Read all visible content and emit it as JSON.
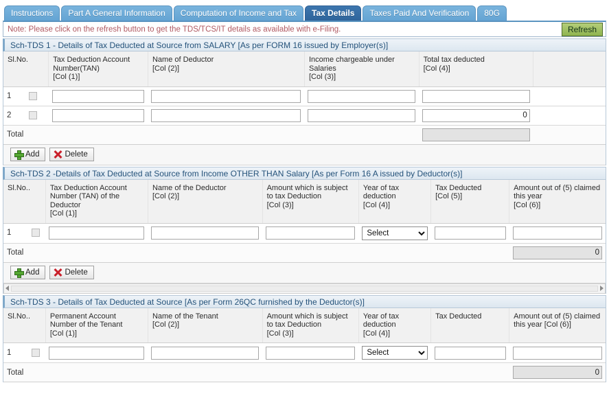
{
  "tabs": [
    {
      "label": "Instructions",
      "active": false
    },
    {
      "label": "Part A General Information",
      "active": false
    },
    {
      "label": "Computation of Income and Tax",
      "active": false
    },
    {
      "label": "Tax Details",
      "active": true
    },
    {
      "label": "Taxes Paid And Verification",
      "active": false
    },
    {
      "label": "80G",
      "active": false
    }
  ],
  "note": {
    "text": "Note: Please click on the refresh button to get the TDS/TCS/IT details as available with e-Filing.",
    "color": "#b05a63",
    "refresh_label": "Refresh"
  },
  "buttons": {
    "add_label": "Add",
    "delete_label": "Delete"
  },
  "common": {
    "total_label": "Total",
    "select_option": "Select"
  },
  "sections": [
    {
      "id": "sch-tds-1",
      "title": "Sch-TDS 1 - Details of Tax Deducted at Source from SALARY [As per FORM 16 issued by Employer(s)]",
      "headers": [
        "Sl.No.",
        "Tax Deduction Account Number(TAN)\n[Col (1)]",
        "Name of Deductor\n[Col (2)]",
        "Income chargeable under Salaries\n[Col (3)]",
        "Total tax deducted\n[Col (4)]"
      ],
      "rows": [
        {
          "slno": "1",
          "tan": "",
          "name": "",
          "income": "",
          "tax": ""
        },
        {
          "slno": "2",
          "tan": "",
          "name": "",
          "income": "",
          "tax": "0"
        }
      ],
      "total_value": "",
      "has_scrollbar": false
    },
    {
      "id": "sch-tds-2",
      "title": "Sch-TDS 2 -Details of Tax Deducted at Source from Income OTHER THAN Salary [As per Form 16 A issued by Deductor(s)]",
      "headers": [
        "Sl.No..",
        "Tax Deduction Account Number (TAN) of the Deductor\n[Col (1)]",
        "Name of the Deductor\n[Col (2)]",
        "Amount which is subject to tax Deduction\n[Col (3)]",
        "Year of tax deduction\n[Col (4)]",
        "Tax Deducted\n[Col (5)]",
        "Amount out of (5) claimed this year\n[Col (6)]"
      ],
      "rows": [
        {
          "slno": "1",
          "tan": "",
          "name": "",
          "amount": "",
          "year": "Select",
          "tax": "",
          "claimed": ""
        }
      ],
      "total_value": "0",
      "has_scrollbar": true
    },
    {
      "id": "sch-tds-3",
      "title": "Sch-TDS 3 - Details of Tax Deducted at Source [As per Form 26QC furnished by the Deductor(s)]",
      "headers": [
        "Sl.No..",
        "Permanent Account Number of the Tenant\n[Col (1)]",
        "Name of the Tenant\n[Col (2)]",
        "Amount which is subject to tax Deduction\n[Col (3)]",
        "Year of tax deduction\n[Col (4)]",
        "Tax Deducted",
        "Amount out of (5) claimed this year [Col (6)]"
      ],
      "rows": [
        {
          "slno": "1",
          "pan": "",
          "name": "",
          "amount": "",
          "year": "Select",
          "tax": "",
          "claimed": ""
        }
      ],
      "total_value": "0",
      "has_scrollbar": false
    }
  ]
}
